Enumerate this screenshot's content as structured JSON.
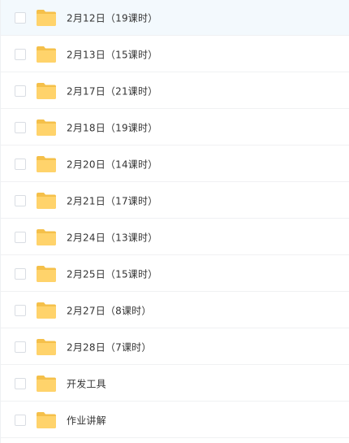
{
  "colors": {
    "folder": "#ffd36b",
    "folder_dark": "#f5c04a",
    "selected_row": "#f3f9fd",
    "text": "#333333"
  },
  "items": [
    {
      "name": "2月12日（19课时）",
      "icon": "folder-icon",
      "selected": true
    },
    {
      "name": "2月13日（15课时）",
      "icon": "folder-icon",
      "selected": false
    },
    {
      "name": "2月17日（21课时）",
      "icon": "folder-icon",
      "selected": false
    },
    {
      "name": "2月18日（19课时）",
      "icon": "folder-icon",
      "selected": false
    },
    {
      "name": "2月20日（14课时）",
      "icon": "folder-icon",
      "selected": false
    },
    {
      "name": "2月21日（17课时）",
      "icon": "folder-icon",
      "selected": false
    },
    {
      "name": "2月24日（13课时）",
      "icon": "folder-icon",
      "selected": false
    },
    {
      "name": "2月25日（15课时）",
      "icon": "folder-icon",
      "selected": false
    },
    {
      "name": "2月27日（8课时）",
      "icon": "folder-icon",
      "selected": false
    },
    {
      "name": "2月28日（7课时）",
      "icon": "folder-icon",
      "selected": false
    },
    {
      "name": "开发工具",
      "icon": "folder-icon",
      "selected": false
    },
    {
      "name": "作业讲解",
      "icon": "folder-icon",
      "selected": false
    }
  ]
}
